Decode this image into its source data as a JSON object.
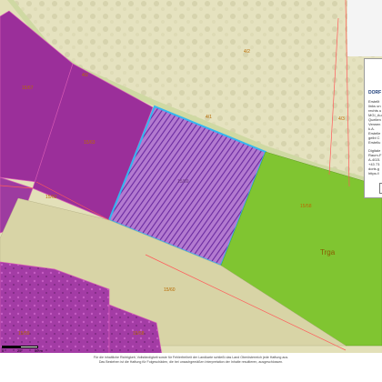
{
  "map": {
    "parcels": [
      {
        "id": "p1",
        "label": "15/67"
      },
      {
        "id": "p2",
        "label": "15/63"
      },
      {
        "id": "p3",
        "label": "15/69"
      },
      {
        "id": "p4",
        "label": "15/62"
      },
      {
        "id": "p5",
        "label": "15/60"
      },
      {
        "id": "p6",
        "label": "15/58"
      },
      {
        "id": "p7",
        "label": "15/59"
      },
      {
        "id": "p8",
        "label": "15/58"
      }
    ],
    "road_labels": [
      "4/2",
      "4/1",
      "4/3",
      "4/2"
    ],
    "land_use_label": "Trga"
  },
  "legend": {
    "title": "DORF",
    "lines": [
      "Erstellt",
      "links un",
      "rechts u",
      "MGI_Au",
      "Quellen",
      "Verwen",
      "k.A.",
      "Erstelle",
      "gelbl C",
      "Erstellu",
      "Digitale",
      "Raum-F",
      "A-4021",
      "+43 73",
      "doris.g",
      "https://"
    ]
  },
  "scale": {
    "labels": [
      "0",
      "25",
      "50 m"
    ]
  },
  "footer": {
    "line1": "Für die inhaltliche Richtigkeit, Vollständigkeit sowie für Fehlerfreiheit der Landkarte schließt das Land Oberösterreich jede Haftung aus.",
    "line2": "Das Bestehen ist die Haftung für Folgeschäden, die bei unsachgemäßen Interpretation der Inhalte resultieren, ausgeschlossen."
  },
  "colors": {
    "forest_magenta": "#9b2f9a",
    "forest_magenta_dark": "#8e3a92",
    "meadow_beige": "#d8d4a6",
    "field_green": "#80c531",
    "selection_outline": "#33b6f0",
    "selection_hatch": "#7f2fae",
    "boundary_red": "#ff5a5a"
  }
}
